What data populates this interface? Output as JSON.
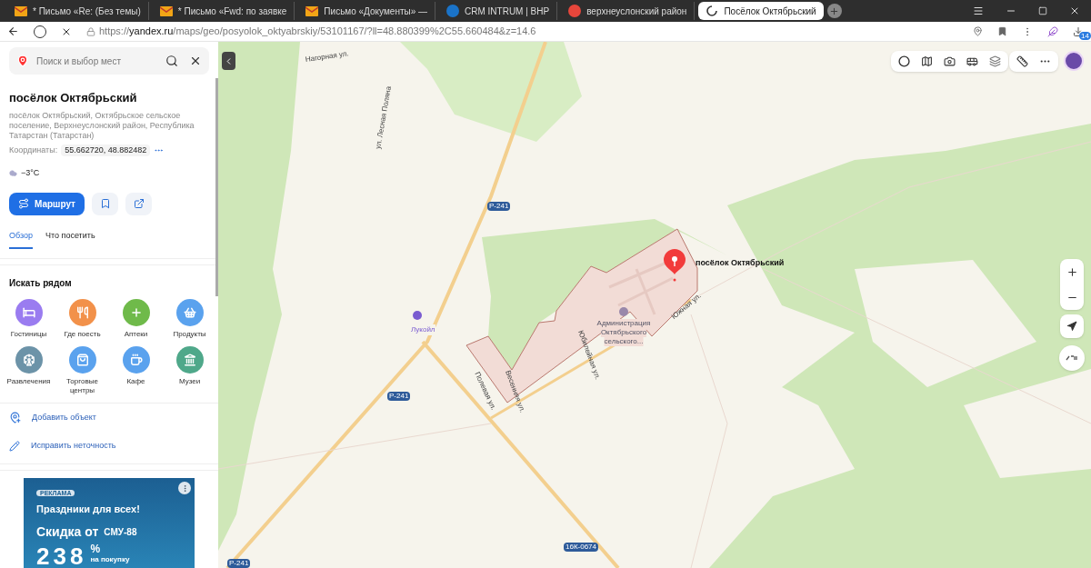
{
  "browser": {
    "tabs": [
      {
        "kind": "mail",
        "label": "* Письмо «Re: (Без темы)",
        "selected": false
      },
      {
        "kind": "mail",
        "label": "* Письмо «Fwd: по заявке",
        "selected": false
      },
      {
        "kind": "mail",
        "label": "Письмо «Документы» —",
        "selected": false
      },
      {
        "kind": "crm",
        "label": "CRM INTRUM | ВНР",
        "selected": false
      },
      {
        "kind": "yandex",
        "label": "верхнеуслонский район",
        "selected": false
      },
      {
        "kind": "loading",
        "label": "Посёлок Октябрьский",
        "selected": true
      }
    ],
    "url_prefix": "https://",
    "url_host": "yandex.ru",
    "url_path": "/maps/geo/posyolok_oktyabrskiy/53101167/?ll=48.880399%2C55.660484&z=14.6",
    "downloads_badge": "14"
  },
  "sidebar": {
    "search": {
      "placeholder": "Поиск и выбор мест"
    },
    "title": "посёлок Октябрьский",
    "address": "посёлок Октябрьский, Октябрьское сельское поселение, Верхнеуслонский район, Республика Татарстан (Татарстан)",
    "coords_label": "Координаты:",
    "coords": "55.662720, 48.882482",
    "weather": "−3°C",
    "route_button": "Маршрут",
    "tabs": [
      {
        "label": "Обзор",
        "selected": true
      },
      {
        "label": "Что посетить",
        "selected": false
      }
    ],
    "nearby_title": "Искать рядом",
    "categories": [
      {
        "kind": "hotel",
        "label": "Гостиницы",
        "color": "#9a7cf0"
      },
      {
        "kind": "food",
        "label": "Где поесть",
        "color": "#f2914a"
      },
      {
        "kind": "pharmacy",
        "label": "Аптеки",
        "color": "#6fba4a"
      },
      {
        "kind": "grocery",
        "label": "Продукты",
        "color": "#5aa2ee"
      },
      {
        "kind": "fun",
        "label": "Развлечения",
        "color": "#6c93a8"
      },
      {
        "kind": "mall",
        "label": "Торговые центры",
        "color": "#5aa2ee"
      },
      {
        "kind": "cafe",
        "label": "Кафе",
        "color": "#5aa2ee"
      },
      {
        "kind": "museum",
        "label": "Музеи",
        "color": "#4fa88a"
      }
    ],
    "actions": [
      {
        "kind": "add",
        "label": "Добавить объект"
      },
      {
        "kind": "edit",
        "label": "Исправить неточность"
      }
    ],
    "ad": {
      "tag": "РЕКЛАМА",
      "headline": "Праздники для всех!",
      "discount": "Скидка от",
      "brand": "СМУ-88",
      "number": "238",
      "percent": "%",
      "note": "на покупку"
    }
  },
  "map": {
    "pin_label": "посёлок Октябрьский",
    "labels": [
      {
        "kind": "street",
        "text": "Нагорная ул."
      },
      {
        "kind": "street",
        "text": "ул. Лесная Поляна"
      },
      {
        "kind": "shield",
        "text": "Р-241"
      },
      {
        "kind": "shield",
        "text": "Р-241"
      },
      {
        "kind": "shield",
        "text": "Р-241"
      },
      {
        "kind": "shield",
        "text": "16К-0674"
      },
      {
        "kind": "poi",
        "text": "Лукойл"
      },
      {
        "kind": "street",
        "text": "Юбилейная ул."
      },
      {
        "kind": "street",
        "text": "Южная ул."
      },
      {
        "kind": "street",
        "text": "Весенняя ул."
      },
      {
        "kind": "street",
        "text": "Полевая ул."
      },
      {
        "kind": "admin",
        "text": "Администрация"
      },
      {
        "kind": "admin",
        "text": "Октябрьского"
      },
      {
        "kind": "admin",
        "text": "сельского..."
      }
    ]
  }
}
